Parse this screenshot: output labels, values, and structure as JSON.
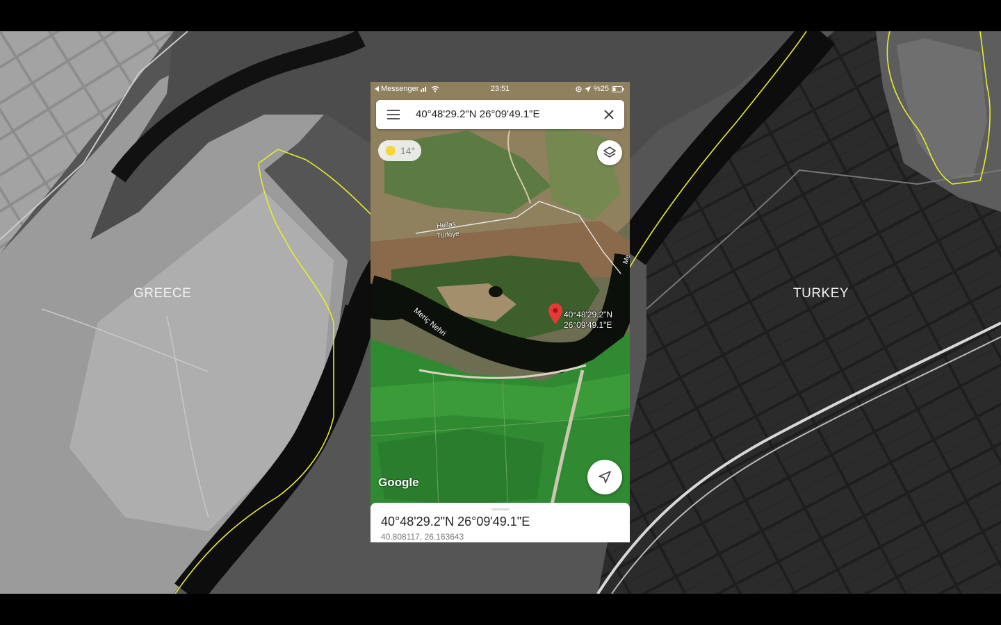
{
  "labels": {
    "left_country": "GREECE",
    "right_country": "TURKEY"
  },
  "colors": {
    "border_line": "#e6ee2a",
    "pin": "#e53935",
    "river": "#0c100b"
  },
  "phone": {
    "status": {
      "back_app": "Messenger",
      "time": "23:51",
      "battery": "%25"
    },
    "search": {
      "value": "40°48'29.2\"N 26°09'49.1\"E"
    },
    "weather": {
      "temperature": "14°"
    },
    "map_labels": {
      "border_upper": "Hellas",
      "border_lower": "Türkiye",
      "river": "Meriç Nehri",
      "edge": "Me"
    },
    "pin": {
      "line1": "40°48'29.2\"N",
      "line2": "26°09'49.1\"E"
    },
    "google": "Google",
    "sheet": {
      "title": "40°48'29.2\"N 26°09'49.1\"E",
      "subtitle": "40.808117, 26.163643"
    },
    "icons": [
      "menu-icon",
      "close-icon",
      "sun-icon",
      "layers-icon",
      "navigation-arrow-icon",
      "map-pin-icon",
      "back-arrow-icon",
      "signal-icon",
      "wifi-icon",
      "location-icon",
      "battery-icon"
    ]
  }
}
